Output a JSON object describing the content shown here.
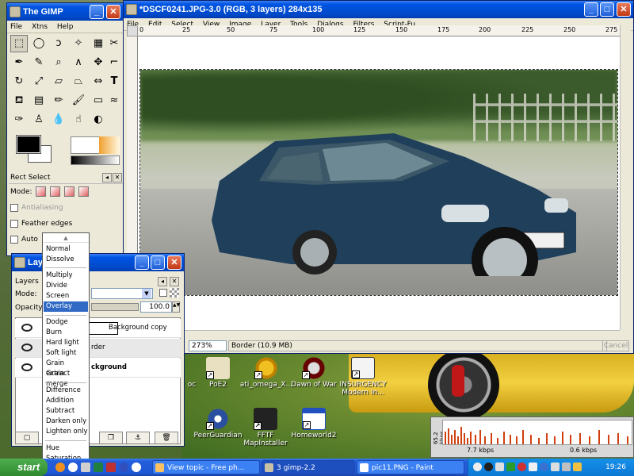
{
  "image_window": {
    "title": "*DSCF0241.JPG-3.0 (RGB, 3 layers) 284x135",
    "menu": [
      "File",
      "Edit",
      "Select",
      "View",
      "Image",
      "Layer",
      "Tools",
      "Dialogs",
      "Filters",
      "Script-Fu"
    ],
    "ruler_ticks": [
      "0",
      "25",
      "50",
      "75",
      "100",
      "125",
      "150",
      "175",
      "200",
      "225",
      "250",
      "275"
    ],
    "zoom": "273%",
    "status": "Border (10.9 MB)",
    "cancel": "Cancel"
  },
  "toolbox": {
    "title": "The GIMP",
    "menu": [
      "File",
      "Xtns",
      "Help"
    ],
    "tool_options_title": "Rect Select",
    "mode_label": "Mode:",
    "antialiasing": "Antialiasing",
    "feather": "Feather edges",
    "auto": "Auto"
  },
  "layers": {
    "title": "Laye",
    "tab": "Layers",
    "mode_label": "Mode:",
    "opacity_label": "Opacity:",
    "opacity_value": "100.0",
    "rows": [
      {
        "name": "Background copy"
      },
      {
        "name": "rder"
      },
      {
        "name": "ckground"
      }
    ]
  },
  "blend_menu": {
    "selected": "Overlay",
    "groups": [
      [
        "Normal",
        "Dissolve"
      ],
      [
        "Multiply",
        "Divide",
        "Screen",
        "Overlay"
      ],
      [
        "Dodge",
        "Burn",
        "Hard light",
        "Soft light",
        "Grain extract",
        "Grain merge"
      ],
      [
        "Difference",
        "Addition",
        "Subtract",
        "Darken only",
        "Lighten only"
      ],
      [
        "Hue",
        "Saturation"
      ]
    ]
  },
  "desktop_icons": [
    {
      "label": "PoE2",
      "sub": ""
    },
    {
      "label": "ati_omega_X...",
      "sub": ""
    },
    {
      "label": "Dawn of War",
      "sub": ""
    },
    {
      "label": "INSURGENCY",
      "sub": "Modern In..."
    },
    {
      "label": "PeerGuardian",
      "sub": ""
    },
    {
      "label": "FFTF",
      "sub": "MapInstaller"
    },
    {
      "label": "Homeworld2",
      "sub": ""
    },
    {
      "label": "oc",
      "sub": ""
    }
  ],
  "net_meter": {
    "down": "7.7 kbps",
    "up": "0.6 kbps",
    "peak": "65.2 kbps"
  },
  "taskbar": {
    "start": "start",
    "tasks": [
      "View topic - Free ph...",
      "3 gimp-2.2",
      "pic11.PNG - Paint"
    ],
    "clock": "19:26"
  }
}
